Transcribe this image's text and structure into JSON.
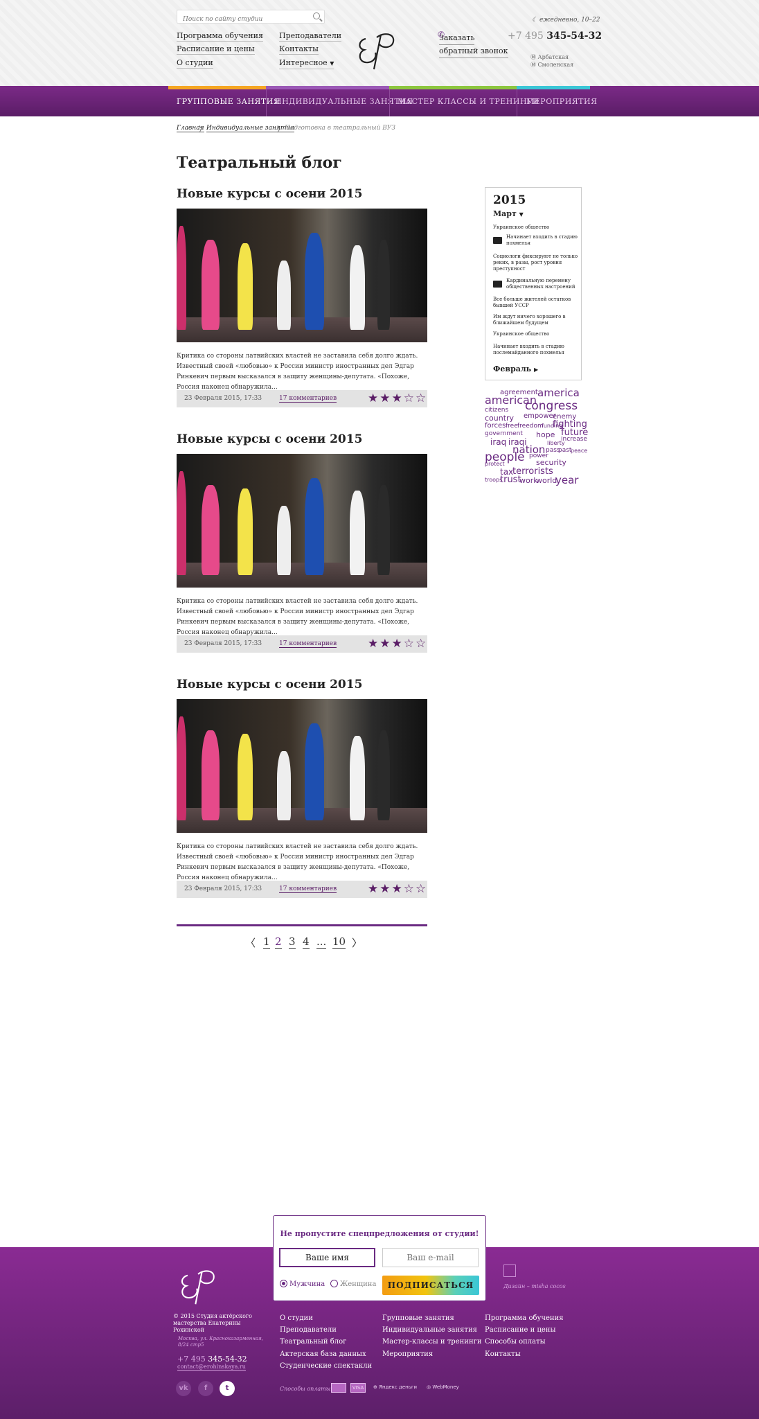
{
  "header": {
    "search_placeholder": "Поиск по сайту студии",
    "nav_left": [
      "Программа обучения",
      "Расписание и цены",
      "О студии"
    ],
    "nav_mid": [
      "Преподаватели",
      "Контакты",
      "Интересное"
    ],
    "callback": [
      "Заказать",
      "обратный звонок"
    ],
    "hours": "ежедневно, 10–22",
    "phone_code": "+7 495",
    "phone_number": "345-54-32",
    "metro": [
      "Арбатская",
      "Смоленская"
    ]
  },
  "mainnav": {
    "items": [
      "ГРУППОВЫЕ ЗАНЯТИЯ",
      "ИНДИВИДУАЛЬНЫЕ ЗАНЯТИЯ",
      "МАСТЕР КЛАССЫ И ТРЕНИНГИ",
      "МЕРОПРИЯТИЯ"
    ],
    "stripe_colors": [
      "#f5a623",
      "#9b59b6",
      "#8dc63f",
      "#3bc6d6"
    ]
  },
  "breadcrumb": [
    "Главная",
    "Индивидуальные занятия",
    "Подготовка в театральный ВУЗ"
  ],
  "page_title": "Театральный блог",
  "posts": [
    {
      "title": "Новые курсы с осени 2015",
      "excerpt": "Критика со стороны латвийских властей не заставила себя долго ждать. Известный своей «любовью» к России министр иностранных дел Эдгар Ринкевич первым высказался в защиту женщины-депутата. «Похоже, Россия наконец обнаружила...",
      "date": "23 Февраля 2015, 17:33",
      "comments": "17 комментариев",
      "rating": 3
    },
    {
      "title": "Новые курсы с осени 2015",
      "excerpt": "Критика со стороны латвийских властей не заставила себя долго ждать. Известный своей «любовью» к России министр иностранных дел Эдгар Ринкевич первым высказался в защиту женщины-депутата. «Похоже, Россия наконец обнаружила...",
      "date": "23 Февраля 2015, 17:33",
      "comments": "17 комментариев",
      "rating": 3
    },
    {
      "title": "Новые курсы с осени 2015",
      "excerpt": "Критика со стороны латвийских властей не заставила себя долго ждать. Известный своей «любовью» к России министр иностранных дел Эдгар Ринкевич первым высказался в защиту женщины-депутата. «Похоже, Россия наконец обнаружила...",
      "date": "23 Февраля 2015, 17:33",
      "comments": "17 комментариев",
      "rating": 3
    }
  ],
  "pagination": {
    "prev": "〈",
    "pages": [
      "1",
      "2",
      "3",
      "4",
      "...",
      "10"
    ],
    "current": "2",
    "next": "〉"
  },
  "sidebar": {
    "year": "2015",
    "month": "Март",
    "items": [
      {
        "text": "Украинское общество",
        "icon": ""
      },
      {
        "text": "Начинает входить в стадию похмелья",
        "icon": "video-icon"
      },
      {
        "text": "Социологи фиксируют не только реких, в разы, рост уровня преступност",
        "icon": ""
      },
      {
        "text": "Кардинальную перемену общественных настроений",
        "icon": "camera-icon"
      },
      {
        "text": "Все больше жителей остатков бывшей УССР",
        "icon": ""
      },
      {
        "text": "Им ждут ничего хорошего в ближайшем будущем",
        "icon": ""
      },
      {
        "text": "Украинское общество",
        "icon": ""
      },
      {
        "text": "Начинает входить в стадию послемайданного похмелья",
        "icon": ""
      }
    ],
    "prev_month": "Февраль"
  },
  "tag_cloud": [
    "agreement",
    "america",
    "american",
    "citizens",
    "congress",
    "country",
    "empower",
    "enemy",
    "fighting",
    "forces",
    "free",
    "freedom",
    "funding",
    "future",
    "government",
    "hope",
    "increase",
    "iraq",
    "iraqi",
    "liberty",
    "nation",
    "pass",
    "past",
    "peace",
    "people",
    "power",
    "protect",
    "security",
    "tax",
    "terrorists",
    "troops",
    "trust",
    "work",
    "world",
    "year"
  ],
  "subscribe": {
    "title": "Не пропустите спецпредложения от студии!",
    "name_value": "Ваше имя",
    "email_placeholder": "Ваш e-mail",
    "gender_male": "Мужчина",
    "gender_female": "Женщина",
    "selected_gender": "Мужчина",
    "button": "ПОДПИСАТЬСЯ"
  },
  "footer": {
    "copyright": "© 2015 Студия актёрского мастерства Екатерины Рохинской",
    "address": "Москва, ул. Красноказарменная, 8/24 стр5",
    "phone_code": "+7 495",
    "phone_number": "345-54-32",
    "email": "contact@erohinskaya.ru",
    "social": [
      "vk",
      "f",
      "t"
    ],
    "col1": [
      "О студии",
      "Преподаватели",
      "Театральный блог",
      "Актерская база данных",
      "Студенческие спектакли"
    ],
    "col2": [
      "Групповые занятия",
      "Индивидуальные занятия",
      "Мастер-классы и тренинги",
      "Мероприятия"
    ],
    "col3": [
      "Программа обучения",
      "Расписание и цены",
      "Способы оплаты",
      "Контакты"
    ],
    "payments_label": "Способы оплаты:",
    "payments": [
      "MasterCard",
      "VISA",
      "Яндекс деньги",
      "WebMoney"
    ],
    "design": "Дизайн – misha cocos"
  }
}
